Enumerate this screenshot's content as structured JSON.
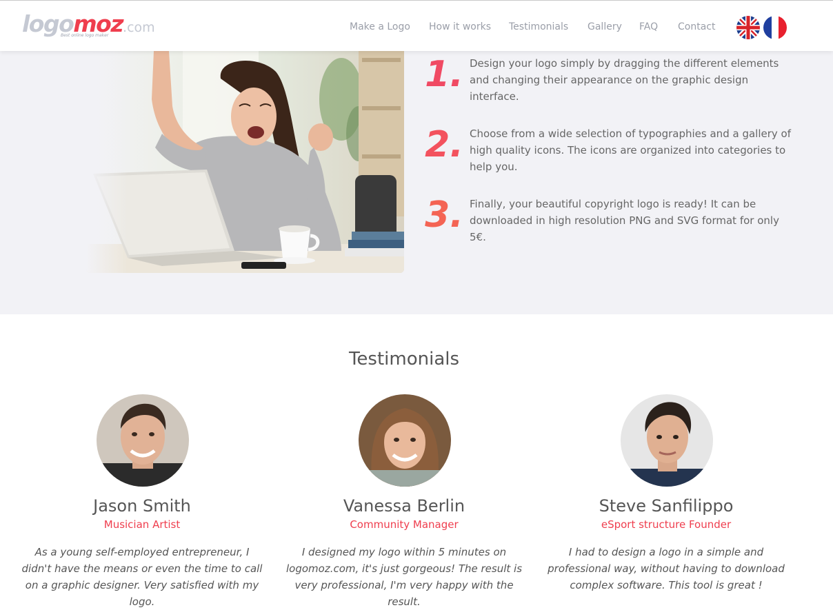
{
  "brand": {
    "logo_part1": "logo",
    "logo_part2": "moz",
    "logo_suffix": ".com",
    "tagline": "Best online logo maker",
    "accent_color": "#ef3e4e",
    "grey_color": "#c5c9d3"
  },
  "nav": {
    "items": [
      {
        "label": "Make a Logo"
      },
      {
        "label": "How it works"
      },
      {
        "label": "Testimonials"
      },
      {
        "label": "Gallery"
      },
      {
        "label": "FAQ"
      },
      {
        "label": "Contact"
      }
    ],
    "languages": [
      {
        "icon": "uk-flag-icon"
      },
      {
        "icon": "france-flag-icon"
      }
    ]
  },
  "how_it_works": {
    "steps": [
      {
        "number": "1.",
        "text": "Design your logo simply by dragging the different elements and changing their appearance on the graphic design interface."
      },
      {
        "number": "2.",
        "text": "Choose from a wide selection of typographies and a gallery of high quality icons. The icons are organized into categories to help you."
      },
      {
        "number": "3.",
        "text": "Finally, your beautiful copyright logo is ready! It can be downloaded in high resolution PNG and SVG format for only 5€."
      }
    ]
  },
  "testimonials": {
    "title": "Testimonials",
    "items": [
      {
        "name": "Jason Smith",
        "role": "Musician Artist",
        "quote": "As a young self-employed entrepreneur, I didn't have the means or even the time to call on a graphic designer. Very satisfied with my logo."
      },
      {
        "name": "Vanessa Berlin",
        "role": "Community Manager",
        "quote": "I designed my logo within 5 minutes on logomoz.com, it's just gorgeous! The result is very professional, I'm very happy with the result."
      },
      {
        "name": "Steve Sanfilippo",
        "role": "eSport structure Founder",
        "quote": "I had to design a logo in a simple and professional way, without having to download complex software. This tool is great !"
      }
    ]
  }
}
